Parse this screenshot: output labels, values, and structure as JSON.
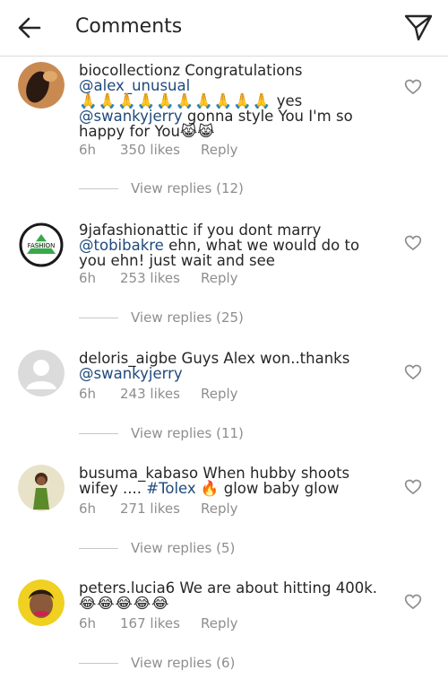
{
  "header": {
    "title": "Comments",
    "back_icon": "arrow-left-icon",
    "send_icon": "send-icon"
  },
  "comments": [
    {
      "username": "biocollectionz",
      "text_1": " Congratulations",
      "mention_1": "@alex_unusual",
      "emojis": "🙏🙏🙏🙏🙏🙏🙏🙏🙏🙏",
      "text_2": " yes",
      "mention_2": "@swankyjerry",
      "text_3": " gonna style You I'm so happy for You😹😹",
      "time": "6h",
      "likes": "350 likes",
      "reply": "Reply",
      "replies": "View replies (12)"
    },
    {
      "username": "9jafashionattic",
      "text_1": " if you dont marry",
      "mention_1": "@tobibakre",
      "text_2": " ehn, what we would do to you ehn! just wait and see",
      "time": "6h",
      "likes": "253 likes",
      "reply": "Reply",
      "replies": "View replies (25)"
    },
    {
      "username": "deloris_aigbe",
      "text_1": " Guys Alex won..thanks",
      "mention_1": "@swankyjerry",
      "time": "6h",
      "likes": "243 likes",
      "reply": "Reply",
      "replies": "View replies (11)"
    },
    {
      "username": "busuma_kabaso",
      "text_1": " When hubby shoots wifey ....",
      "hashtag_1": "#Tolex",
      "text_2": " 🔥 glow baby glow",
      "time": "6h",
      "likes": "271 likes",
      "reply": "Reply",
      "replies": "View replies (5)"
    },
    {
      "username": "peters.lucia6",
      "text_1": " We are about hitting 400k.",
      "emojis": "😂😂😂😂😂",
      "time": "6h",
      "likes": "167 likes",
      "reply": "Reply",
      "replies": "View replies (6)"
    }
  ],
  "colors": {
    "mention": "#1f4a7a",
    "meta": "#8e8e8e",
    "divider": "#dbdbdb"
  }
}
